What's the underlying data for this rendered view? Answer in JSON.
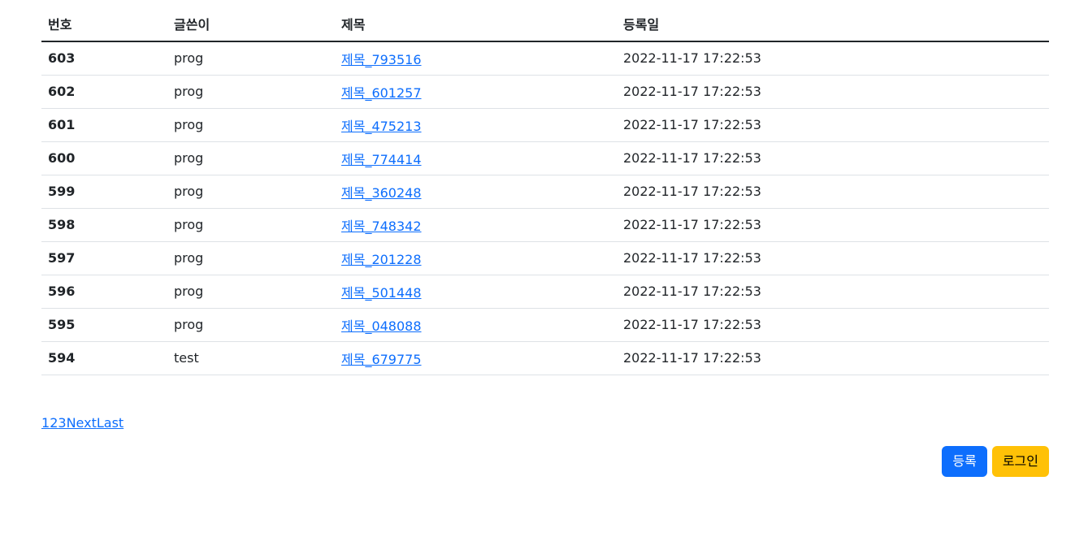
{
  "table": {
    "headers": [
      "번호",
      "글쓴이",
      "제목",
      "등록일"
    ],
    "rows": [
      {
        "no": "603",
        "writer": "prog",
        "title": "제목_793516",
        "date": "2022-11-17 17:22:53"
      },
      {
        "no": "602",
        "writer": "prog",
        "title": "제목_601257",
        "date": "2022-11-17 17:22:53"
      },
      {
        "no": "601",
        "writer": "prog",
        "title": "제목_475213",
        "date": "2022-11-17 17:22:53"
      },
      {
        "no": "600",
        "writer": "prog",
        "title": "제목_774414",
        "date": "2022-11-17 17:22:53"
      },
      {
        "no": "599",
        "writer": "prog",
        "title": "제목_360248",
        "date": "2022-11-17 17:22:53"
      },
      {
        "no": "598",
        "writer": "prog",
        "title": "제목_748342",
        "date": "2022-11-17 17:22:53"
      },
      {
        "no": "597",
        "writer": "prog",
        "title": "제목_201228",
        "date": "2022-11-17 17:22:53"
      },
      {
        "no": "596",
        "writer": "prog",
        "title": "제목_501448",
        "date": "2022-11-17 17:22:53"
      },
      {
        "no": "595",
        "writer": "prog",
        "title": "제목_048088",
        "date": "2022-11-17 17:22:53"
      },
      {
        "no": "594",
        "writer": "test",
        "title": "제목_679775",
        "date": "2022-11-17 17:22:53"
      }
    ]
  },
  "pagination": {
    "pages": [
      "1",
      "2",
      "3"
    ],
    "next": "Next",
    "last": "Last"
  },
  "buttons": {
    "register": "등록",
    "login": "로그인"
  },
  "colors": {
    "link": "#0d6efd",
    "primary": "#0d6efd",
    "warning": "#ffc107"
  }
}
